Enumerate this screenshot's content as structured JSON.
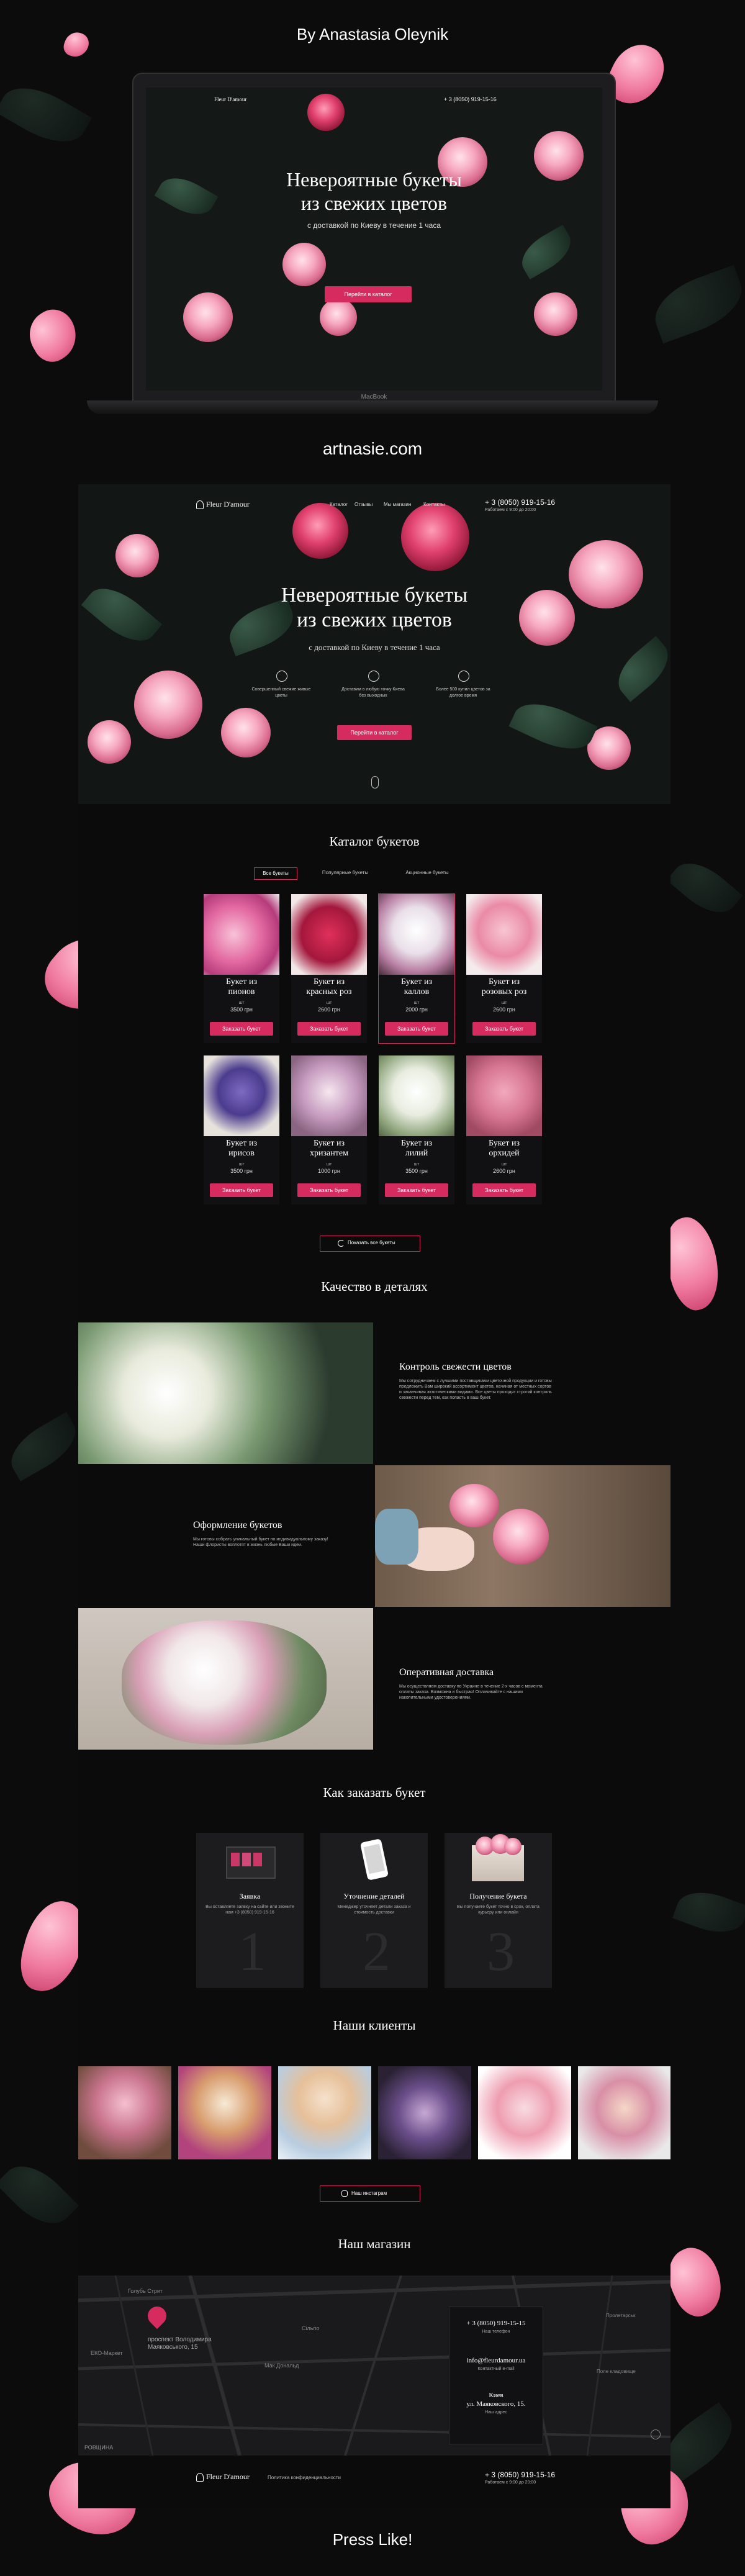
{
  "credit": "By Anastasia Oleynik",
  "site_url": "artnasie.com",
  "footer_cta": "Press Like!",
  "laptop_label": "MacBook",
  "brand": "Fleur D'amour",
  "nav": [
    "Каталог",
    "Отзывы",
    "Мы магазин",
    "Контакты"
  ],
  "phone": "+ 3 (8050) 919-15-16",
  "hours": "Работаем с 9:00 до 20:00",
  "hero": {
    "title_line1": "Невероятные букеты",
    "title_line2": "из свежих цветов",
    "subtitle": "с доставкой по Киеву в течение 1 часа",
    "features": [
      "Совершенный свежие живые цветы",
      "Доставим в любую точку Киева без выходных",
      "Более 500 купил цветов за долгое время"
    ],
    "cta": "Перейти в каталог"
  },
  "catalog": {
    "title": "Каталог букетов",
    "tabs": [
      "Все букеты",
      "Популярные букеты",
      "Акционные букеты"
    ],
    "volume_label": "шт",
    "products": [
      {
        "name_l1": "Букет из",
        "name_l2": "пионов",
        "price": "3500 грн"
      },
      {
        "name_l1": "Букет из",
        "name_l2": "красных роз",
        "price": "2600 грн"
      },
      {
        "name_l1": "Букет из",
        "name_l2": "каллов",
        "price": "2000 грн"
      },
      {
        "name_l1": "Букет из",
        "name_l2": "розовых роз",
        "price": "2600 грн"
      },
      {
        "name_l1": "Букет из",
        "name_l2": "ирисов",
        "price": "3500 грн"
      },
      {
        "name_l1": "Букет из",
        "name_l2": "хризантем",
        "price": "1000 грн"
      },
      {
        "name_l1": "Букет из",
        "name_l2": "лилий",
        "price": "3500 грн"
      },
      {
        "name_l1": "Букет из",
        "name_l2": "орхидей",
        "price": "2600 грн"
      }
    ],
    "order_button": "Заказать букет",
    "show_all": "Показать все букеты"
  },
  "quality": {
    "title": "Качество в деталях",
    "items": [
      {
        "heading": "Контроль свежести цветов",
        "text": "Мы сотрудничаем с лучшими поставщиками цветочной продукции и готовы предложить Вам широкий ассортимент цветов, начиная от местных сортов и заканчивая экзотическими видами. Все цветы проходят строгий контроль свежести перед тем, как попасть в ваш букет."
      },
      {
        "heading": "Оформление букетов",
        "text": "Мы готовы собрать уникальный букет по индивидуальному заказу! Наши флористы воплотят в жизнь любые Ваши идеи."
      },
      {
        "heading": "Оперативная доставка",
        "text": "Мы осуществляем доставку по Украине в течение 2-х часов с момента оплаты заказа. Возможна и быстрая! Оплачивайте с нашими накопительными удостоверениями."
      }
    ]
  },
  "how": {
    "title": "Как заказать букет",
    "steps": [
      {
        "num": "1",
        "title": "Заявка",
        "text": "Вы оставляете заявку на сайте или звоните нам +3 (8050) 919-15-16"
      },
      {
        "num": "2",
        "title": "Уточнение деталей",
        "text": "Менеджер уточняет детали заказа и стоимость доставки"
      },
      {
        "num": "3",
        "title": "Получение букета",
        "text": "Вы получаете букет точно в срок, оплата курьеру или онлайн"
      }
    ]
  },
  "clients": {
    "title": "Наши клиенты",
    "instagram": "Наш инстаграм"
  },
  "shop": {
    "title": "Наш магазин",
    "map_labels": [
      "Голубь Стрит",
      "ЕКО-Маркет",
      "проспект Володимира Маяковського, 15",
      "Сільпо",
      "Мак Дональд",
      "РОВЩИНА",
      "Поле кладовище",
      "Пролетарськ"
    ],
    "phone": "+ 3 (8050) 919-15-15",
    "phone_label": "Наш телефон",
    "email": "info@fleurdamour.ua",
    "email_label": "Контактный e-mail",
    "city": "Киев",
    "street": "ул. Маяковского, 15.",
    "addr_label": "Наш адрес"
  },
  "footer": {
    "policy": "Политика конфиденциальности",
    "phone": "+ 3 (8050) 919-15-16",
    "hours": "Работаем с 9:00 до 20:00"
  }
}
